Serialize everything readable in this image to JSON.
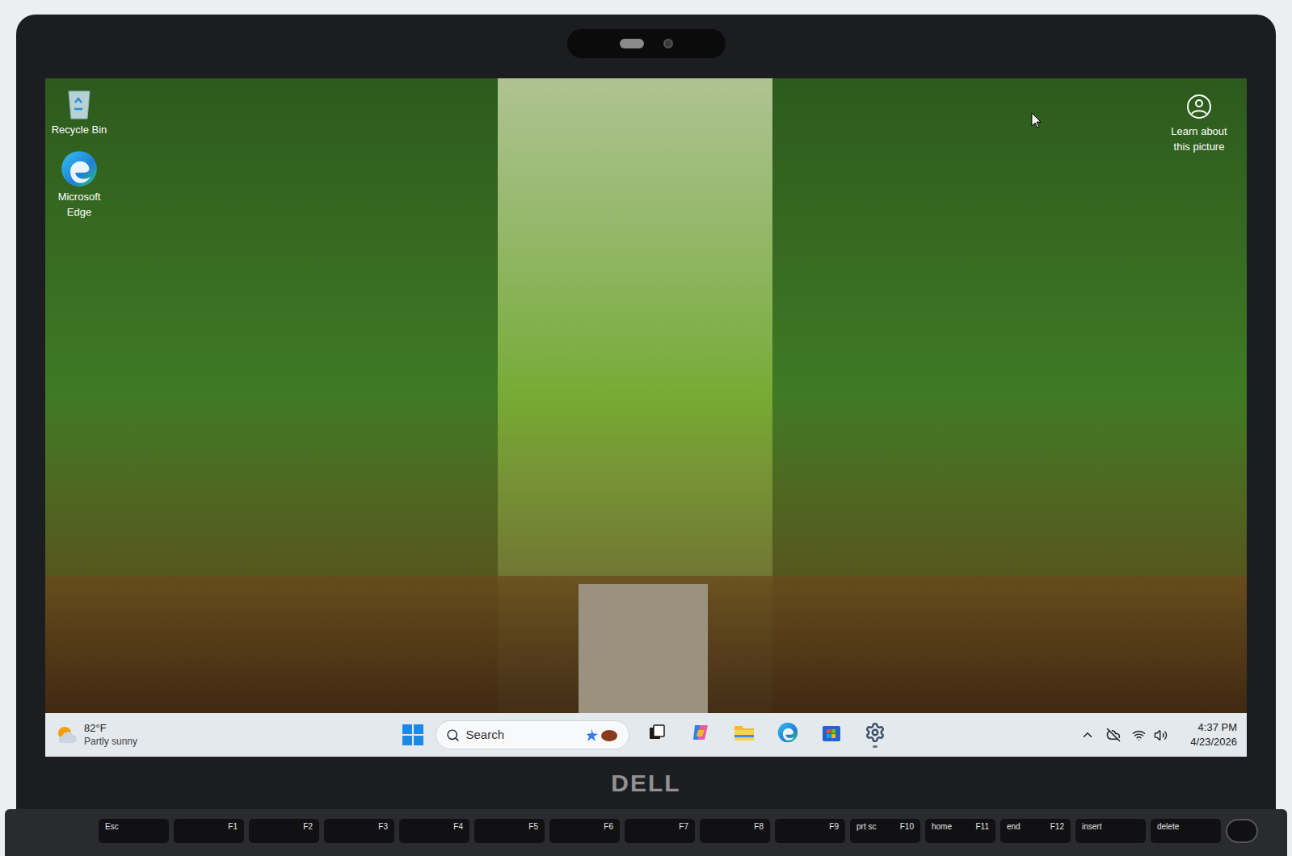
{
  "desktop": {
    "icons": [
      {
        "label": "Recycle Bin",
        "kind": "recycle-bin"
      },
      {
        "label": "Microsoft Edge",
        "kind": "edge"
      }
    ],
    "spotlight": {
      "label": "Learn about this picture"
    }
  },
  "taskbar": {
    "weather": {
      "temperature": "82°F",
      "condition": "Partly sunny"
    },
    "search": {
      "placeholder": "Search"
    },
    "apps": [
      {
        "kind": "task-view",
        "running": false
      },
      {
        "kind": "copilot",
        "running": false
      },
      {
        "kind": "explorer",
        "running": false
      },
      {
        "kind": "edge",
        "running": false
      },
      {
        "kind": "store",
        "running": false
      },
      {
        "kind": "settings",
        "running": true
      }
    ],
    "clock": {
      "time": "4:37 PM",
      "date": "4/23/2026"
    }
  },
  "logo": "DELL",
  "keys": [
    {
      "main": "Esc",
      "fn": ""
    },
    {
      "main": "",
      "fn": "F1"
    },
    {
      "main": "",
      "fn": "F2"
    },
    {
      "main": "",
      "fn": "F3"
    },
    {
      "main": "",
      "fn": "F4"
    },
    {
      "main": "",
      "fn": "F5"
    },
    {
      "main": "",
      "fn": "F6"
    },
    {
      "main": "",
      "fn": "F7"
    },
    {
      "main": "",
      "fn": "F8"
    },
    {
      "main": "",
      "fn": "F9"
    },
    {
      "main": "prt sc",
      "fn": "F10"
    },
    {
      "main": "home",
      "fn": "F11"
    },
    {
      "main": "end",
      "fn": "F12"
    },
    {
      "main": "insert",
      "fn": ""
    },
    {
      "main": "delete",
      "fn": ""
    }
  ]
}
